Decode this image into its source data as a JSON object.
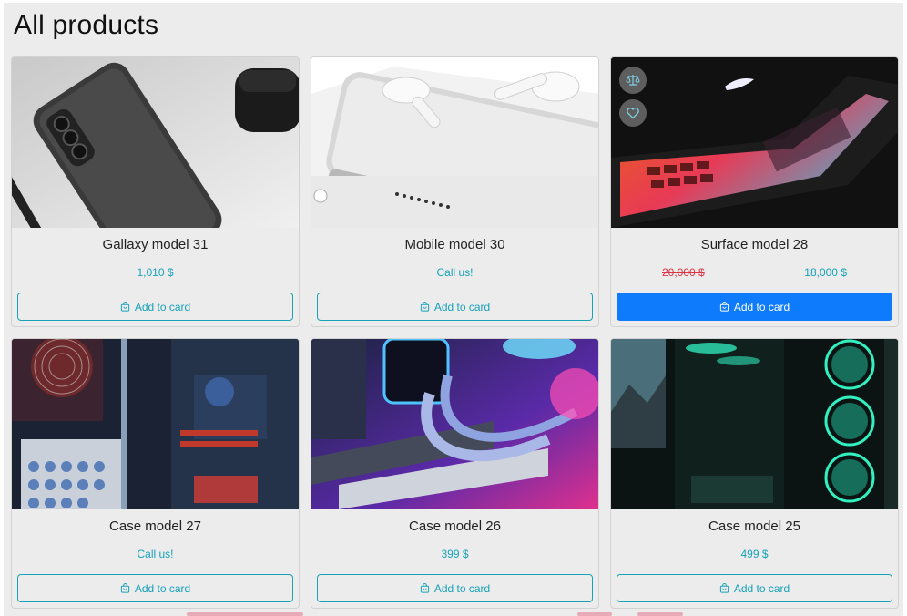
{
  "page": {
    "title": "All products"
  },
  "products": [
    {
      "title": "Gallaxy model 31",
      "price": "1,010 $",
      "button_label": "Add to card",
      "image": "samsung-phone-and-earbuds"
    },
    {
      "title": "Mobile model 30",
      "price": "Call us!",
      "button_label": "Add to card",
      "image": "white-phone-and-airpods"
    },
    {
      "title": "Surface model 28",
      "old_price": "20,000 $",
      "price": "18,000 $",
      "button_label": "Add to card",
      "image": "laptop-with-glowing-keyboard",
      "actions": {
        "compare_icon": "scale-icon",
        "wishlist_icon": "heart-icon"
      }
    },
    {
      "title": "Case model 27",
      "price": "Call us!",
      "button_label": "Add to card",
      "image": "pc-case-interior-red-fan"
    },
    {
      "title": "Case model 26",
      "price": "399 $",
      "button_label": "Add to card",
      "image": "rgb-pc-liquid-cooling"
    },
    {
      "title": "Case model 25",
      "price": "499 $",
      "button_label": "Add to card",
      "image": "pc-case-green-fans"
    }
  ],
  "colors": {
    "accent": "#17a2b8",
    "primary_button": "#0d7bfb",
    "old_price": "#dc3545",
    "background": "#ececec"
  }
}
